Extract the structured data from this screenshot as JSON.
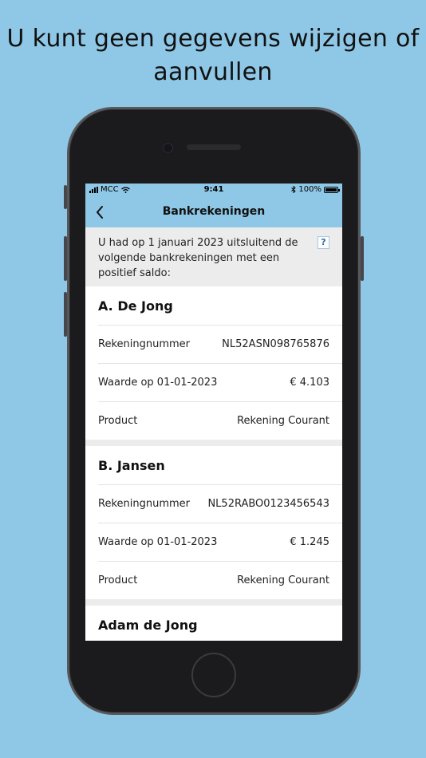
{
  "headline": {
    "line1": "U kunt geen gegevens wijzigen of",
    "line2": "aanvullen"
  },
  "status_bar": {
    "carrier": "MCC",
    "time": "9:41",
    "battery": "100%"
  },
  "nav": {
    "title": "Bankrekeningen",
    "back_icon": "chevron-left-icon"
  },
  "intro": {
    "text": "U had op 1 januari 2023 uitsluitend de volgende bankrekeningen met een positief saldo:",
    "help_label": "?"
  },
  "accounts": [
    {
      "name": "A. De Jong",
      "rows": [
        {
          "label": "Rekeningnummer",
          "value": "NL52ASN098765876"
        },
        {
          "label": "Waarde op 01-01-2023",
          "value": "€ 4.103"
        },
        {
          "label": "Product",
          "value": "Rekening Courant"
        }
      ]
    },
    {
      "name": "B. Jansen",
      "rows": [
        {
          "label": "Rekeningnummer",
          "value": "NL52RABO0123456543"
        },
        {
          "label": "Waarde op 01-01-2023",
          "value": "€ 1.245"
        },
        {
          "label": "Product",
          "value": "Rekening Courant"
        }
      ]
    },
    {
      "name": "Adam de Jong",
      "rows": []
    }
  ],
  "colors": {
    "background": "#8fc8e6",
    "nav_bar": "#8fc8e6",
    "section_gray": "#ececec",
    "card": "#ffffff"
  }
}
